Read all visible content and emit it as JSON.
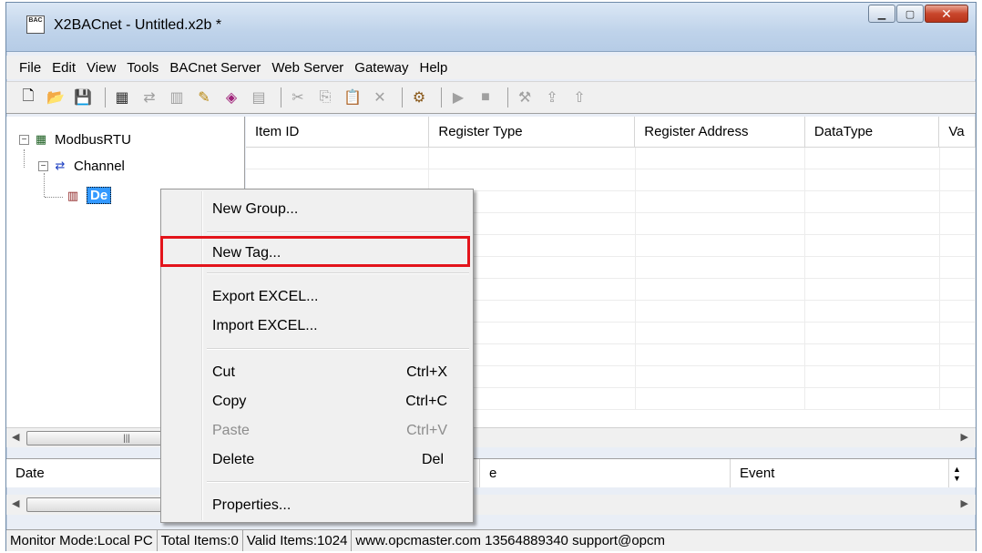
{
  "window": {
    "title": "X2BACnet - Untitled.x2b *",
    "icon_text": "BAC"
  },
  "menubar": [
    "File",
    "Edit",
    "View",
    "Tools",
    "BACnet Server",
    "Web Server",
    "Gateway",
    "Help"
  ],
  "tree": {
    "root": "ModbusRTU",
    "channel": "Channel",
    "device": "De"
  },
  "grid": {
    "columns": [
      "Item ID",
      "Register Type",
      "Register Address",
      "DataType",
      "Va"
    ]
  },
  "log": {
    "columns": [
      "Date",
      "e",
      "Event"
    ]
  },
  "status": {
    "monitor": "Monitor Mode:Local PC",
    "total": "Total Items:0",
    "valid": "Valid Items:1024",
    "contact": "www.opcmaster.com 13564889340 support@opcm"
  },
  "context_menu": {
    "new_group": "New Group...",
    "new_tag": "New Tag...",
    "export_excel": "Export EXCEL...",
    "import_excel": "Import EXCEL...",
    "cut": "Cut",
    "cut_sc": "Ctrl+X",
    "copy": "Copy",
    "copy_sc": "Ctrl+C",
    "paste": "Paste",
    "paste_sc": "Ctrl+V",
    "delete": "Delete",
    "delete_sc": "Del",
    "properties": "Properties..."
  },
  "colors": {
    "highlight": "#e3141b",
    "selection": "#3399ff"
  }
}
